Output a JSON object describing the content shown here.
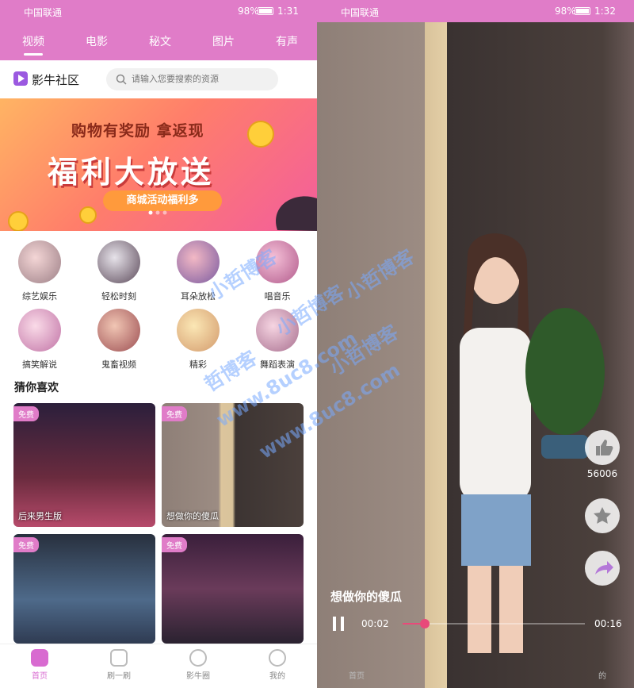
{
  "left": {
    "status": {
      "carrier": "中国联通",
      "battery": "98%",
      "time": "1:31"
    },
    "tabs": [
      {
        "label": "视频"
      },
      {
        "label": "电影"
      },
      {
        "label": "秘文"
      },
      {
        "label": "图片"
      },
      {
        "label": "有声"
      }
    ],
    "brand": "影牛社区",
    "search": {
      "placeholder": "请输入您要搜索的资源"
    },
    "banner": {
      "subtitle": "购物有奖励 拿返现",
      "title": "福利大放送",
      "pill": "商城活动福利多"
    },
    "categories": [
      {
        "label": "综艺娱乐"
      },
      {
        "label": "轻松时刻"
      },
      {
        "label": "耳朵放松"
      },
      {
        "label": "唱音乐"
      },
      {
        "label": "搞笑解说"
      },
      {
        "label": "鬼畜视频"
      },
      {
        "label": "精彩"
      },
      {
        "label": "舞蹈表演"
      }
    ],
    "section_title": "猜你喜欢",
    "cards": [
      {
        "badge": "免费",
        "title": "后来男生版"
      },
      {
        "badge": "免费",
        "title": "想做你的傻瓜"
      },
      {
        "badge": "免费",
        "title": ""
      },
      {
        "badge": "免费",
        "title": ""
      }
    ],
    "nav": [
      {
        "label": "首页"
      },
      {
        "label": "刷一刷"
      },
      {
        "label": "影牛圈"
      },
      {
        "label": "我的"
      }
    ]
  },
  "right": {
    "status": {
      "carrier": "中国联通",
      "battery": "98%",
      "time": "1:32"
    },
    "like_count": "56006",
    "video_title": "想做你的傻瓜",
    "current_time": "00:02",
    "total_time": "00:16",
    "progress": 0.12,
    "nav": [
      {
        "label": "首页"
      },
      {
        "label": "的"
      }
    ]
  },
  "watermarks": [
    "小哲博客",
    "小哲博客",
    "www.8uc8.com",
    "www.8uc8.com",
    "哲博客",
    "小哲博客",
    "小哲博客"
  ],
  "colors": {
    "accent": "#e07cc8",
    "progress": "#e84a7a"
  }
}
